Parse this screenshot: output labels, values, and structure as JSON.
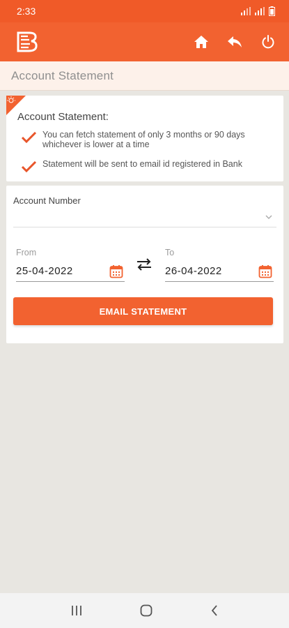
{
  "status_bar": {
    "time": "2:33"
  },
  "header": {
    "title": "Account Statement"
  },
  "info": {
    "heading": "Account Statement:",
    "items": [
      {
        "text": "You can fetch statement of only 3 months or 90 days whichever is lower at a time"
      },
      {
        "text": "Statement will be sent to email id registered in Bank"
      }
    ]
  },
  "form": {
    "account_label": "Account Number",
    "account_value": "",
    "from_label": "From",
    "from_value": "25-04-2022",
    "to_label": "To",
    "to_value": "26-04-2022",
    "submit_label": "EMAIL STATEMENT"
  },
  "icons": {
    "logo": "bank-logo",
    "home": "home-icon",
    "back": "reply-icon",
    "power": "power-icon",
    "calendar": "calendar-icon",
    "swap": "swap-icon"
  },
  "colors": {
    "accent": "#f26230",
    "status_bar": "#f05a28"
  }
}
